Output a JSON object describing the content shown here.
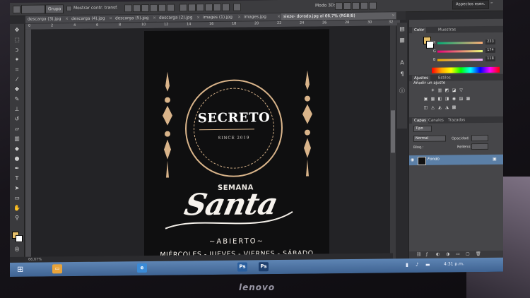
{
  "options_bar": {
    "tool_select": "Grupo",
    "show_transform": "Mostrar contr. transf.",
    "mode_3d": "Modo 3D:"
  },
  "workspace": {
    "label": "Aspectos esen."
  },
  "tabs": [
    {
      "label": "descarga (3).jpg",
      "active": false
    },
    {
      "label": "descarga (4).jpg",
      "active": false
    },
    {
      "label": "descarga (5).jpg",
      "active": false
    },
    {
      "label": "descarga (2).jpg",
      "active": false
    },
    {
      "label": "images (1).jpg",
      "active": false
    },
    {
      "label": "images.jpg",
      "active": false
    },
    {
      "label": "sieze- dorado.jpg al 66,7% (RGB/8)",
      "active": true
    }
  ],
  "ruler_marks": [
    "0",
    "2",
    "4",
    "6",
    "8",
    "10",
    "12",
    "14",
    "16",
    "18",
    "20",
    "22",
    "24",
    "26",
    "28",
    "30",
    "32"
  ],
  "document": {
    "seal_title": "SECRETO",
    "seal_subtitle": "SINCE 2019",
    "semana": "SEMANA",
    "santa": "Santa",
    "abierto": "~ABIERTO~",
    "days": "MIÉRCOLES - JUEVES - VIERNES - SÁBADO"
  },
  "status": {
    "zoom": "66,67%"
  },
  "color_panel": {
    "tab_color": "Color",
    "tab_swatches": "Muestras",
    "r": {
      "label": "R",
      "value": "233"
    },
    "g": {
      "label": "G",
      "value": "174"
    },
    "b": {
      "label": "B",
      "value": "118"
    },
    "foreground": "#e7c06a",
    "background": "#ffffff"
  },
  "adjustments_panel": {
    "tab_adjust": "Ajustes",
    "tab_styles": "Estilos",
    "title": "Añadir un ajuste"
  },
  "layers_panel": {
    "tab_layers": "Capas",
    "tab_channels": "Canales",
    "tab_paths": "Trazados",
    "kind": "Tipo",
    "blend": "Normal",
    "opacity_label": "Opacidad:",
    "lock_label": "Bloq.:",
    "fill_label": "Relleno:",
    "layer_name": "Fondo"
  },
  "taskbar": {
    "time": "4:31 p.m."
  },
  "brand": "lenovo"
}
